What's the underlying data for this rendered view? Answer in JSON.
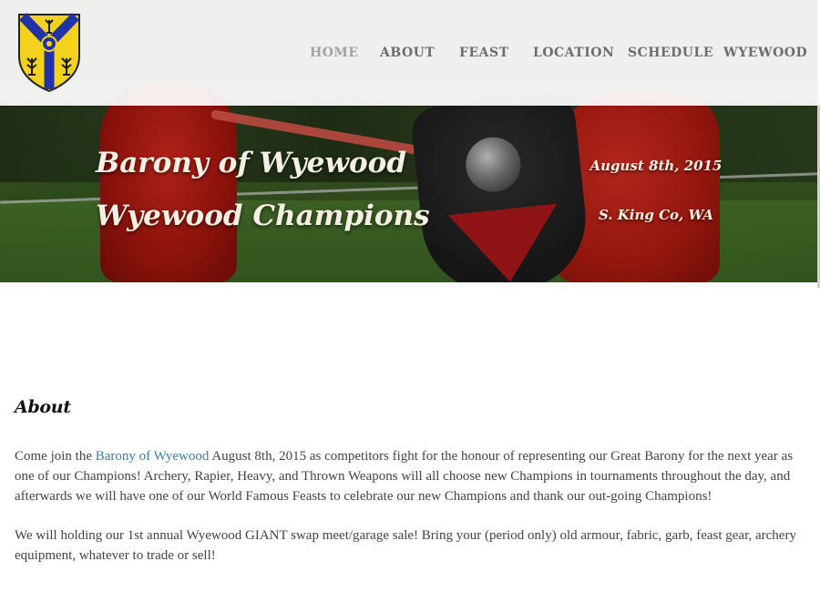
{
  "header": {
    "logo_name": "barony-arms-shield",
    "nav": [
      {
        "label": "HOME",
        "active": true
      },
      {
        "label": "ABOUT",
        "active": false
      },
      {
        "label": "FEAST",
        "active": false
      },
      {
        "label": "LOCATION",
        "active": false
      },
      {
        "label": "SCHEDULE",
        "active": false
      },
      {
        "label": "WYEWOOD",
        "active": false
      }
    ]
  },
  "hero": {
    "title_line1": "Barony of Wyewood",
    "title_line2": "Wyewood Champions",
    "date": "August 8th, 2015",
    "place": "S. King Co, WA"
  },
  "about": {
    "heading": "About",
    "p1_before_link": "Come join the ",
    "p1_link": "Barony of Wyewood",
    "p1_after_link": " August 8th, 2015 as competitors fight for the honour of representing our Great Barony for the next year as one of our Champions! Archery, Rapier, Heavy, and Thrown Weapons will all choose new Champions in tournaments throughout the day, and afterwards we will have one of our World Famous Feasts to celebrate our new Champions and thank our out-going Champions!",
    "p2": "We will holding our 1st annual Wyewood GIANT swap meet/garage sale! Bring your (period only) old armour, fabric, garb, feast gear, archery equipment, whatever to trade or sell!"
  },
  "colors": {
    "link": "#3c7ca4",
    "shield_yellow": "#f2d21a",
    "shield_blue": "#2233a8"
  }
}
